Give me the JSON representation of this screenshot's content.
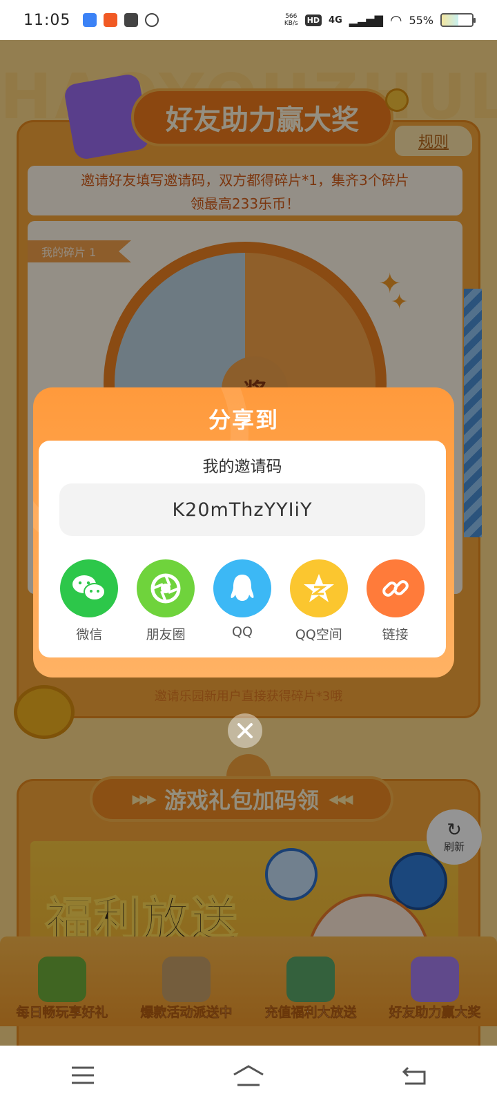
{
  "status_bar": {
    "time": "11:05",
    "net_speed": "566",
    "net_speed_unit": "KB/s",
    "hd_badge": "HD",
    "network": "4G",
    "battery": "55%"
  },
  "page": {
    "watermark": "HAOYOUZHULI",
    "title": "好友助力赢大奖",
    "rules_link": "规则",
    "invite_description": "邀请好友填写邀请码，双方都得碎片*1，集齐3个碎片领最高233乐币！",
    "pieces_tag": "我的碎片 1",
    "wheel_prize_char": "奖",
    "new_user_hint": "邀请乐园新用户直接获得碎片*3哦",
    "section2_title": "游戏礼包加码领",
    "banner_text": "福利放送",
    "refresh_label": "刷新"
  },
  "bottom_tabs": [
    {
      "label": "每日畅玩享好礼",
      "color": "#6fae3c"
    },
    {
      "label": "爆款活动派送中",
      "color": "#c9a06a"
    },
    {
      "label": "充值福利大放送",
      "color": "#5aa86a"
    },
    {
      "label": "好友助力赢大奖",
      "color": "#a57ff0"
    }
  ],
  "share_modal": {
    "title": "分享到",
    "invite_code_label": "我的邀请码",
    "invite_code": "K20mThzYYIiY",
    "options": [
      {
        "label": "微信",
        "icon": "wechat-icon",
        "color": "#2dc74a"
      },
      {
        "label": "朋友圈",
        "icon": "moments-icon",
        "color": "#6fd33c"
      },
      {
        "label": "QQ",
        "icon": "qq-icon",
        "color": "#3cb8f5"
      },
      {
        "label": "QQ空间",
        "icon": "qzone-icon",
        "color": "#fbc62f"
      },
      {
        "label": "链接",
        "icon": "link-icon",
        "color": "#ff7b3a"
      }
    ],
    "close_icon": "close-icon"
  },
  "navbar": {
    "menu_icon": "menu-icon",
    "home_icon": "home-icon",
    "back_icon": "back-icon"
  }
}
